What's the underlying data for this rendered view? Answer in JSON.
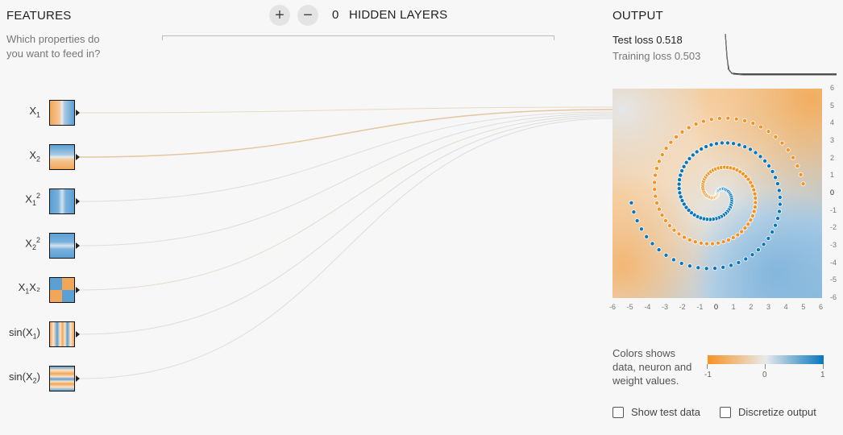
{
  "features": {
    "heading": "FEATURES",
    "subtitle": "Which properties do you want to feed in?",
    "items": [
      {
        "label_main": "X",
        "label_sub": "1",
        "label_sup": "",
        "label_tail": "",
        "kind": "x1"
      },
      {
        "label_main": "X",
        "label_sub": "2",
        "label_sup": "",
        "label_tail": "",
        "kind": "x2"
      },
      {
        "label_main": "X",
        "label_sub": "1",
        "label_sup": "2",
        "label_tail": "",
        "kind": "x1sq"
      },
      {
        "label_main": "X",
        "label_sub": "2",
        "label_sup": "2",
        "label_tail": "",
        "kind": "x2sq"
      },
      {
        "label_main": "X",
        "label_sub": "1",
        "label_sup": "",
        "label_tail": "X₂",
        "kind": "x1x2"
      },
      {
        "label_main": "sin(X",
        "label_sub": "1",
        "label_sup": "",
        "label_tail": ")",
        "kind": "sinx1"
      },
      {
        "label_main": "sin(X",
        "label_sub": "2",
        "label_sup": "",
        "label_tail": ")",
        "kind": "sinx2"
      }
    ]
  },
  "layers": {
    "add_symbol": "+",
    "remove_symbol": "−",
    "count": "0",
    "label": "HIDDEN LAYERS"
  },
  "output": {
    "heading": "OUTPUT",
    "test_loss_label": "Test loss",
    "test_loss_value": "0.518",
    "training_loss_label": "Training loss",
    "training_loss_value": "0.503",
    "x_ticks": [
      "-6",
      "-5",
      "-4",
      "-3",
      "-2",
      "-1",
      "0",
      "1",
      "2",
      "3",
      "4",
      "5",
      "6"
    ],
    "y_ticks": [
      "6",
      "5",
      "4",
      "3",
      "2",
      "1",
      "0",
      "-1",
      "-2",
      "-3",
      "-4",
      "-5",
      "-6"
    ]
  },
  "legend": {
    "text": "Colors shows data, neuron and weight values.",
    "min_label": "-1",
    "mid_label": "0",
    "max_label": "1"
  },
  "controls": {
    "show_test_data": "Show test data",
    "discretize_output": "Discretize output"
  },
  "colors": {
    "orange": "#f59322",
    "blue": "#0877bd",
    "neutral": "#e8eaeb"
  }
}
